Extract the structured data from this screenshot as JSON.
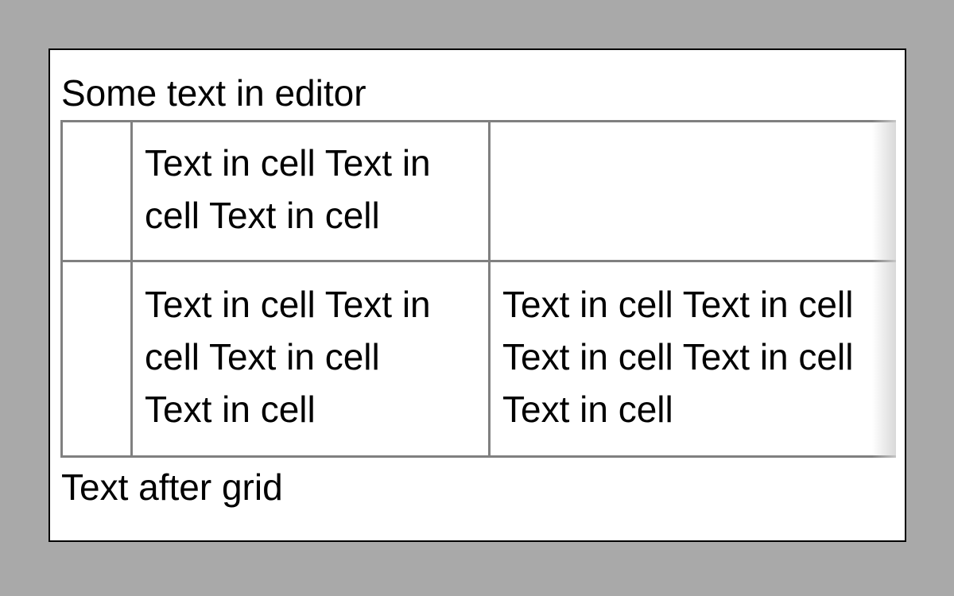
{
  "editor": {
    "text_before": "Some text in editor",
    "text_after": "Text after grid"
  },
  "grid": {
    "rows": [
      {
        "cells": [
          {
            "lines": []
          },
          {
            "lines": [
              "Text in cell Text in",
              "cell Text in cell"
            ]
          },
          {
            "lines": []
          }
        ]
      },
      {
        "cells": [
          {
            "lines": []
          },
          {
            "lines": [
              "Text in cell Text in",
              "cell Text in cell",
              "Text in cell"
            ]
          },
          {
            "lines": [
              "Text in cell Text in cell",
              "Text in cell Text in cell",
              "Text in cell"
            ]
          }
        ]
      }
    ]
  }
}
